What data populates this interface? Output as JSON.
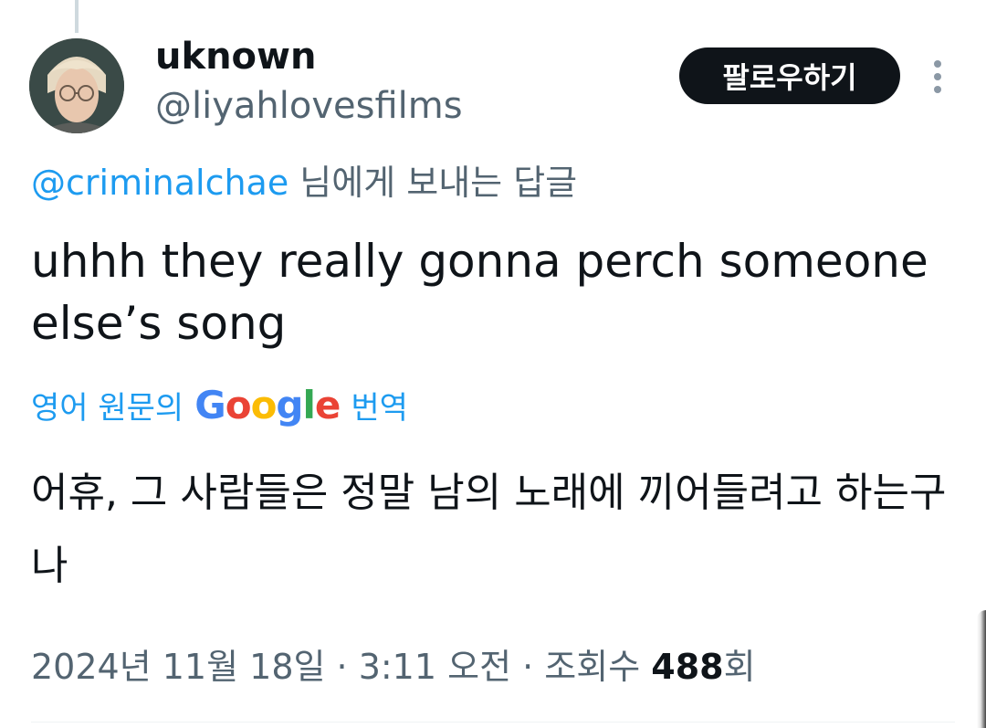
{
  "tweet": {
    "author": {
      "display_name": "uknown",
      "handle": "@liyahlovesfilms"
    },
    "follow_label": "팔로우하기",
    "reply_to": {
      "mention": "@criminalchae",
      "suffix": " 님에게 보내는 답글"
    },
    "text": "uhhh they really gonna perch someone else’s song",
    "translation": {
      "prefix": "영어 원문의",
      "provider": "Google",
      "suffix": "번역",
      "text": "어휴, 그 사람들은 정말 남의 노래에 끼어들려고 하는구나"
    },
    "meta": {
      "date": "2024년 11월 18일",
      "separator": " · ",
      "time": "3:11 오전",
      "views_label": "조회수",
      "views_count": "488",
      "views_unit": "회"
    }
  },
  "icons": {
    "more": "more-vertical-icon"
  },
  "colors": {
    "link": "#1d9bf0",
    "muted": "#536471",
    "text": "#0f1419",
    "button_bg": "#0f1419"
  }
}
